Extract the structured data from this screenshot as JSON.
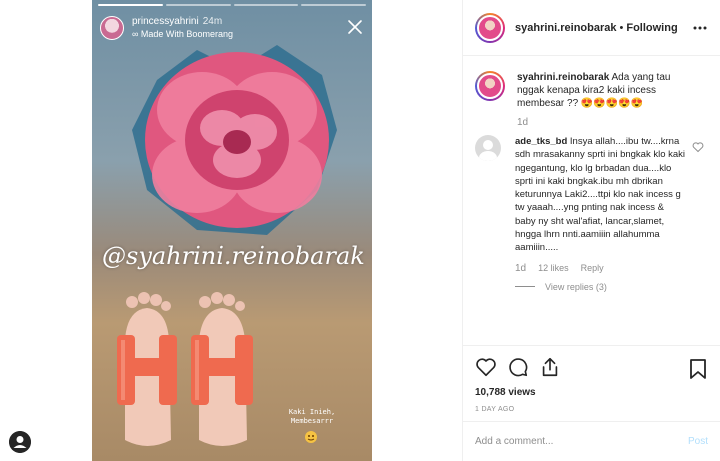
{
  "story": {
    "username": "princessyahrini",
    "time_ago": "24m",
    "subtitle": "∞ Made With Boomerang",
    "watermark": "@syahrini.reinobarak",
    "note_line1": "Kaki Inieh,",
    "note_line2": "Membesarrr",
    "segments": 4,
    "active_segment": 0
  },
  "post": {
    "header": {
      "username": "syahrini.reinobarak",
      "separator": "•",
      "follow_state": "Following"
    },
    "caption": {
      "username": "syahrini.reinobarak",
      "text": "Ada yang tau nggak kenapa kira2 kaki incess membesar ?? 😍😍😍😍😍",
      "time": "1d"
    },
    "comments": [
      {
        "username": "ade_tks_bd",
        "text": "Insya allah....ibu tw....krna sdh mrasakanny sprti ini bngkak klo kaki ngegantung, klo lg brbadan dua....klo sprti ini kaki bngkak.ibu mh dbrikan keturunnya Laki2....ttpi klo nak incess g tw yaaah....yng pnting nak incess & baby ny sht wal'afiat, lancar,slamet, hngga lhrn nnti.aamiiin allahumma aamiiin.....",
        "time": "1d",
        "likes": "12 likes",
        "reply_label": "Reply",
        "view_replies": "View replies (3)"
      }
    ],
    "views": "10,788 views",
    "date": "1 DAY AGO",
    "comment_placeholder": "Add a comment...",
    "post_label": "Post"
  },
  "colors": {
    "accent_disabled": "#b2dffc",
    "muted": "#8e8e8e",
    "border": "#efefef"
  },
  "icons": [
    "close-icon",
    "more-icon",
    "heart-icon",
    "comment-icon",
    "share-icon",
    "bookmark-icon",
    "avatar-icon"
  ]
}
